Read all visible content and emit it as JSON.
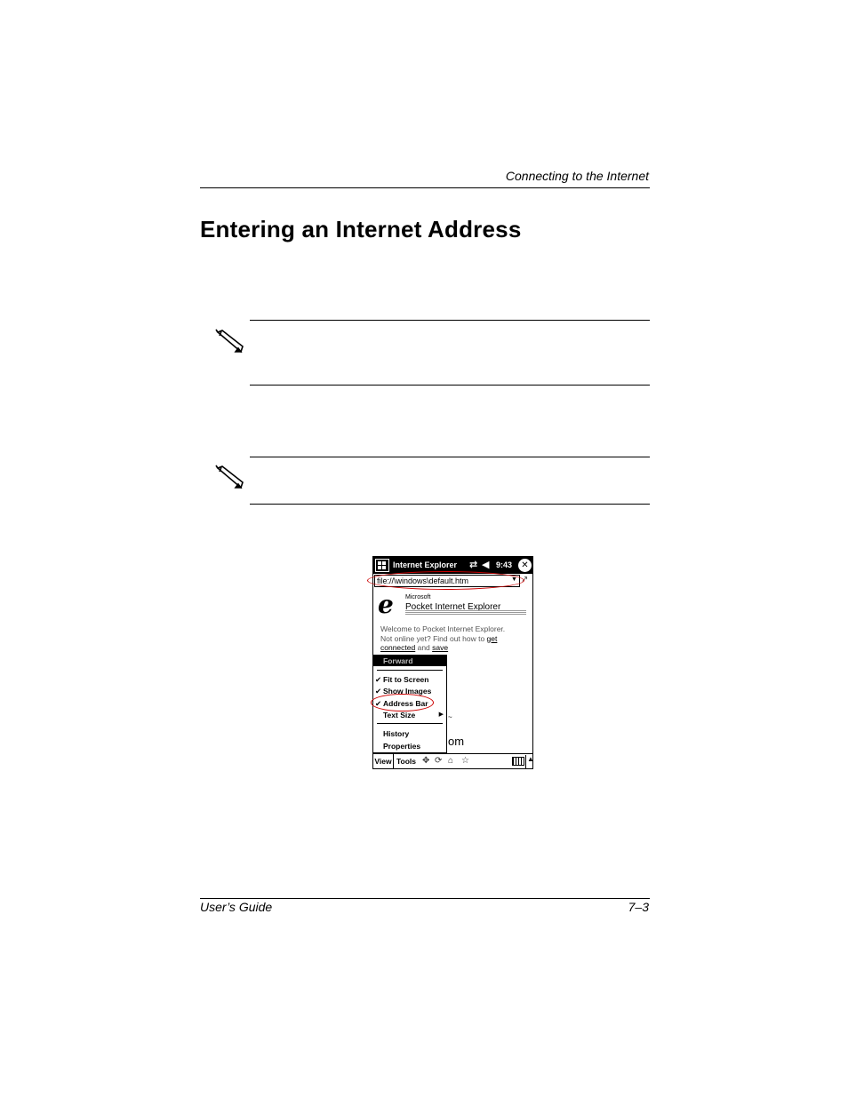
{
  "header": {
    "chapter_title": "Connecting to the Internet"
  },
  "section": {
    "title": "Entering an Internet Address"
  },
  "notes": [
    {
      "icon": "pencil-note-icon"
    },
    {
      "icon": "pencil-note-icon"
    }
  ],
  "screenshot": {
    "title_bar": {
      "app_title": "Internet Explorer",
      "time": "9:43"
    },
    "address_bar": {
      "value": "file://\\windows\\default.htm"
    },
    "logo": {
      "brand": "Microsoft",
      "product_word": "Pocket",
      "product_name": "Internet Explorer"
    },
    "welcome": {
      "text_before": "Welcome to Pocket Internet Explorer. Not online yet? Find out how to ",
      "link_connected": "get connected",
      "text_middle": " and ",
      "link_save": "save"
    },
    "view_menu": {
      "items": [
        {
          "label": "Forward",
          "checked": false,
          "highlighted": true
        },
        {
          "label": "Fit to Screen",
          "checked": true
        },
        {
          "label": "Show Images",
          "checked": true
        },
        {
          "label": "Address Bar",
          "checked": true
        },
        {
          "label": "Text Size",
          "checked": false,
          "submenu": true
        },
        {
          "label": "History",
          "checked": false
        },
        {
          "label": "Properties",
          "checked": false
        }
      ]
    },
    "background_text": "om",
    "toolbar": {
      "view_label": "View",
      "tools_label": "Tools"
    }
  },
  "footer": {
    "left": "User’s Guide",
    "right": "7–3"
  }
}
